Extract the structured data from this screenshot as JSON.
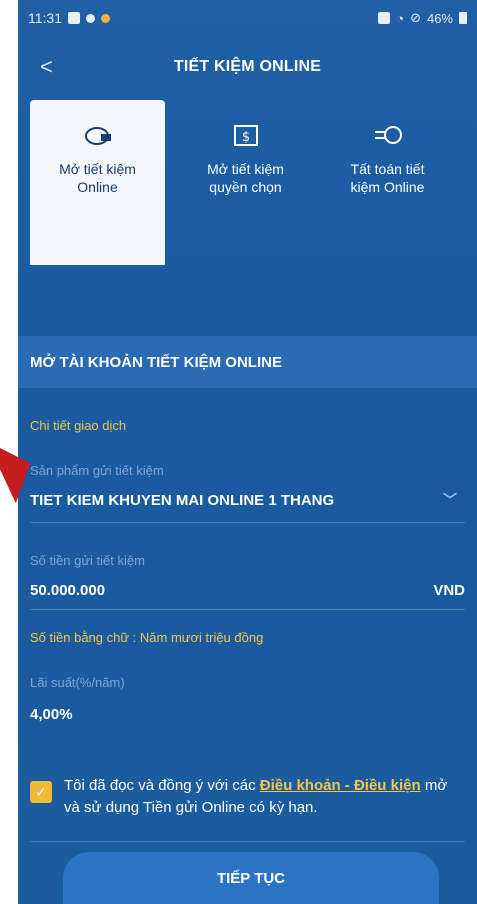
{
  "status_bar": {
    "time": "11:31",
    "battery": "46%"
  },
  "header": {
    "back": "<",
    "title": "TIẾT KIỆM ONLINE"
  },
  "tabs": [
    {
      "line1": "Mở tiết kiệm",
      "line2": "Online",
      "icon": "piggy-bank-icon"
    },
    {
      "line1": "Mở tiết kiệm",
      "line2": "quyền chọn",
      "icon": "dollar-calendar-icon"
    },
    {
      "line1": "Tất toán tiết",
      "line2": "kiệm Online",
      "icon": "coin-transfer-icon"
    }
  ],
  "section_title": "MỞ TÀI KHOẢN TIẾT KIỆM ONLINE",
  "form": {
    "detail_heading": "Chi tiết giao dịch",
    "product_label": "Sản phẩm gửi tiết kiệm",
    "product_value": "TIET KIEM KHUYEN MAI ONLINE 1 THANG",
    "amount_label": "Số tiền gửi tiết kiệm",
    "amount_value": "50.000.000",
    "currency": "VND",
    "amount_words": "Số tiền bằng chữ : Năm mươi triệu đồng",
    "rate_label": "Lãi suất(%/năm)",
    "rate_value": "4,00%"
  },
  "agreement": {
    "prefix": "Tôi đã đọc và đồng ý với các ",
    "link": "Điều khoản - Điều kiện",
    "suffix": " mở và sử dụng Tiền gửi Online có kỳ hạn."
  },
  "continue_label": "TIẾP TỤC",
  "colors": {
    "primary_blue": "#1f5fa6",
    "accent_yellow": "#f2c64a",
    "arrow_red": "#c41e1e"
  }
}
